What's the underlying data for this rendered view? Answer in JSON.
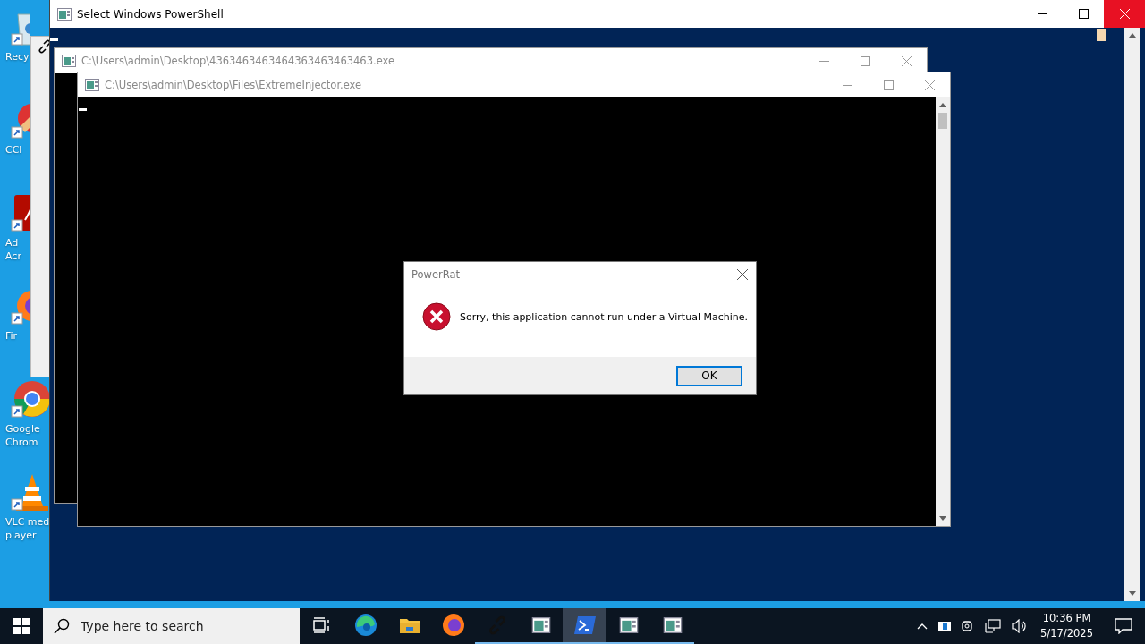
{
  "desktop_icons": [
    {
      "kind": "recycle",
      "lines": [
        "Recy"
      ]
    },
    {
      "kind": "ccleaner",
      "lines": [
        "CCl"
      ]
    },
    {
      "kind": "acrobat",
      "lines": [
        "Ad",
        "Acr"
      ]
    },
    {
      "kind": "firefox",
      "lines": [
        "Fir"
      ]
    },
    {
      "kind": "chrome",
      "lines": [
        "Google",
        "Chrom"
      ]
    },
    {
      "kind": "vlc",
      "lines": [
        "VLC med",
        "player"
      ]
    }
  ],
  "powershell_window": {
    "title": "Select Windows PowerShell",
    "close_highlighted": true
  },
  "console_windows": [
    {
      "title": "C:\\Users\\admin\\Desktop\\4363463463464363463463463.exe"
    },
    {
      "title": "C:\\Users\\admin\\Desktop\\Files\\ExtremeInjector.exe"
    }
  ],
  "dialog": {
    "title": "PowerRat",
    "message": "Sorry, this application cannot run under a Virtual Machine.",
    "button": "OK"
  },
  "taskbar": {
    "search_placeholder": "Type here to search",
    "items": [
      {
        "kind": "taskview",
        "running": false,
        "selected": false
      },
      {
        "kind": "edge",
        "running": false,
        "selected": false
      },
      {
        "kind": "explorer",
        "running": false,
        "selected": false
      },
      {
        "kind": "firefox",
        "running": false,
        "selected": false
      },
      {
        "kind": "link",
        "running": true,
        "selected": false
      },
      {
        "kind": "console",
        "running": true,
        "selected": false
      },
      {
        "kind": "powershell",
        "running": true,
        "selected": true
      },
      {
        "kind": "console",
        "running": true,
        "selected": false
      },
      {
        "kind": "console",
        "running": true,
        "selected": false
      }
    ],
    "time": "10:36 PM",
    "date": "5/17/2025"
  }
}
